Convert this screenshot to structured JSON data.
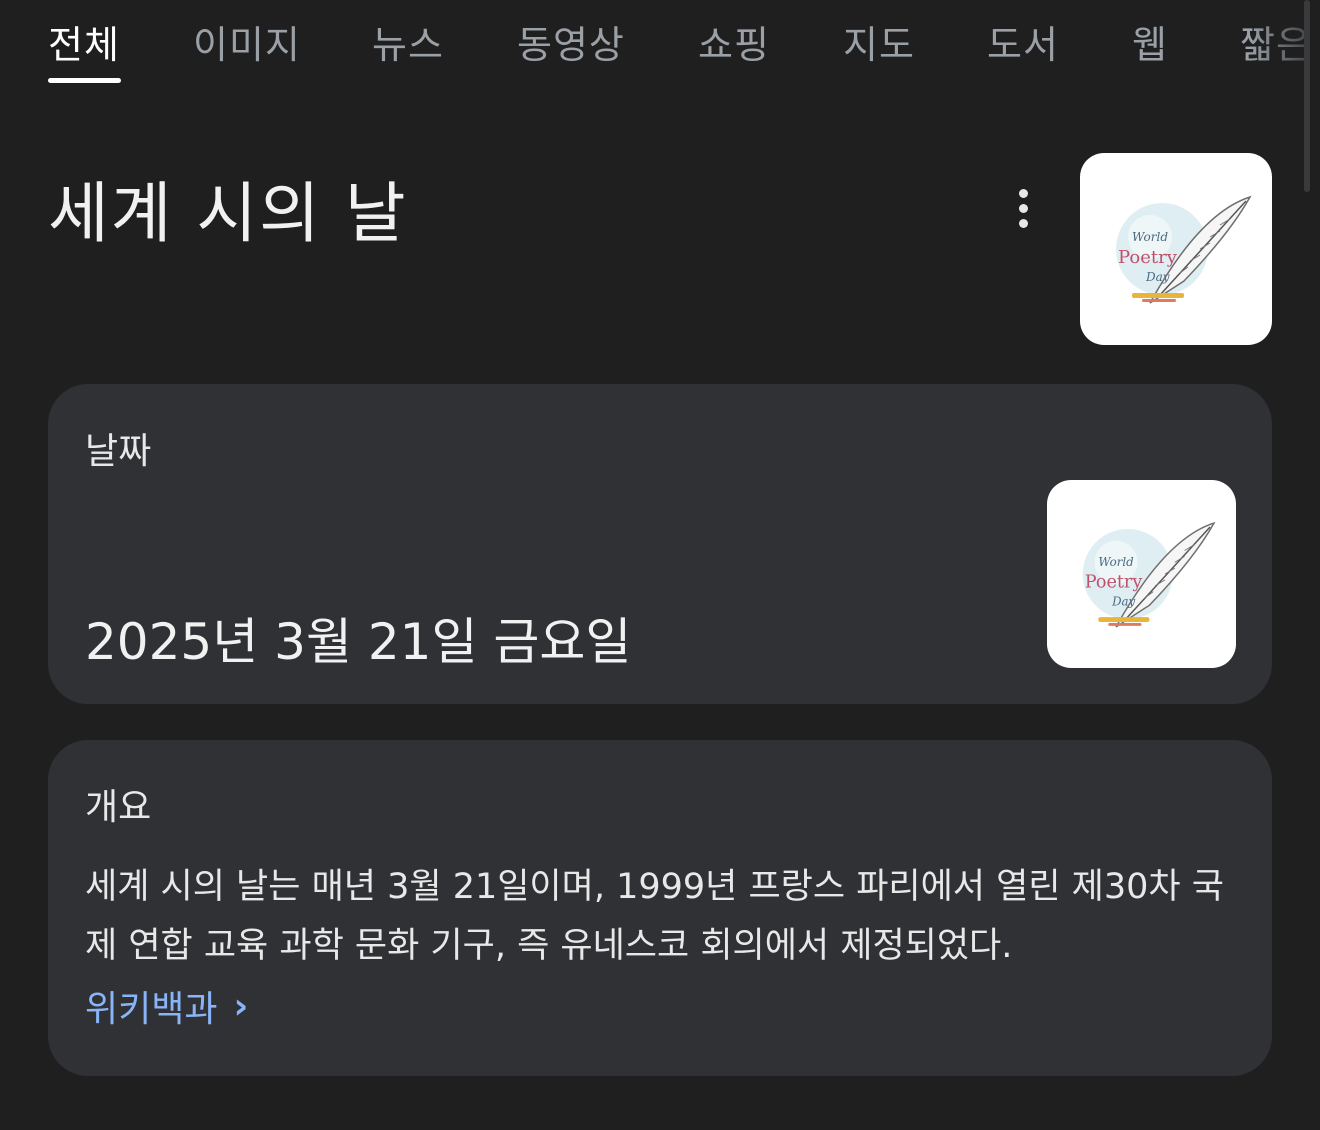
{
  "tabs": [
    {
      "label": "전체",
      "active": true
    },
    {
      "label": "이미지"
    },
    {
      "label": "뉴스"
    },
    {
      "label": "동영상"
    },
    {
      "label": "쇼핑"
    },
    {
      "label": "지도"
    },
    {
      "label": "도서"
    },
    {
      "label": "웹"
    },
    {
      "label": "짧은"
    }
  ],
  "title": "세계 시의 날",
  "more_icon": "more-vertical-icon",
  "image_text": {
    "script": "World",
    "main": "Poetry",
    "script2": "Day"
  },
  "date_card": {
    "label": "날짜",
    "value": "2025년 3월 21일 금요일"
  },
  "overview_card": {
    "label": "개요",
    "text": "세계 시의 날는 매년 3월 21일이며, 1999년 프랑스 파리에서 열린 제30차 국제 연합 교육 과학 문화 기구, 즉 유네스코 회의에서 제정되었다.",
    "source_link": "위키백과",
    "chevron": "›"
  },
  "colors": {
    "background": "#1f1f20",
    "card": "#303134",
    "link": "#8ab4f8"
  }
}
